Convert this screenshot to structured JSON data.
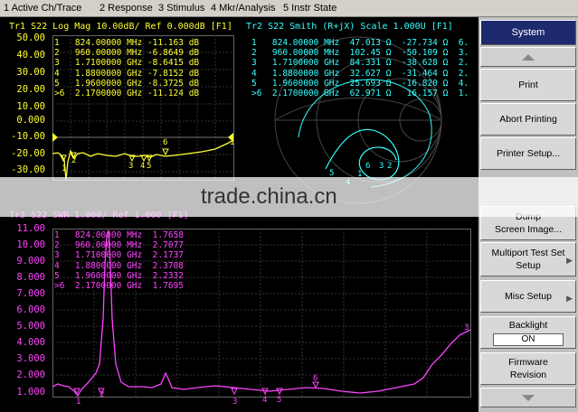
{
  "menu": [
    "1 Active Ch/Trace",
    "2 Response",
    "3 Stimulus",
    "4 Mkr/Analysis",
    "5 Instr State"
  ],
  "trace1": {
    "header": "Tr1 S22 Log Mag 10.00dB/ Ref 0.000dB [F1]",
    "yticks": [
      "50.00",
      "40.00",
      "30.00",
      "20.00",
      "10.00",
      "0.000",
      "-10.00",
      "-20.00",
      "-30.00"
    ],
    "markers": [
      "1   824.00000 MHz -11.163 dB",
      "2   960.00000 MHz -6.8649 dB",
      "3   1.7100000 GHz -8.6415 dB",
      "4   1.8800000 GHz -7.8152 dB",
      "5   1.9600000 GHz -8.3725 dB",
      ">6  2.1700000 GHz -11.124 dB"
    ],
    "marker_labels": [
      "1",
      "2",
      "3",
      "4",
      "5",
      "6",
      "1"
    ],
    "color": "#ffff33"
  },
  "trace2": {
    "header": "Tr2 S22 Smith (R+jX) Scale 1.000U [F1]",
    "markers": [
      "1   824.00000 MHz  47.013 Ω  -27.734 Ω  6.",
      "2   960.00000 MHz  102.45 Ω  -50.109 Ω  3.",
      "3   1.7100000 GHz  84.331 Ω  -38.628 Ω  2.",
      "4   1.8800000 GHz  32.627 Ω  -31.464 Ω  2.",
      "5   1.9600000 GHz  25.693 Ω  -16.820 Ω  4.",
      ">6  2.1700000 GHz  62.971 Ω   16.157 Ω  1."
    ],
    "marker_labels": [
      "5",
      "4",
      "1",
      "6",
      "3",
      "2"
    ],
    "color": "#33ffff"
  },
  "trace3": {
    "header": "Tr3 S22 SWR 1.000/ Ref 1.000 [F1]",
    "yticks": [
      "11.00",
      "10.00",
      "9.000",
      "8.000",
      "7.000",
      "6.000",
      "5.000",
      "4.000",
      "3.000",
      "2.000",
      "1.000"
    ],
    "markers": [
      "1   824.00000 MHz  1.7658",
      "2   960.00000 MHz  2.7077",
      "3   1.7100000 GHz  2.1737",
      "4   1.8800000 GHz  2.3708",
      "5   1.9600000 GHz  2.2332",
      ">6  2.1700000 GHz  1.7695"
    ],
    "marker_labels": [
      "1",
      "2",
      "3",
      "4",
      "5",
      "6",
      "3"
    ],
    "color": "#ff44ff"
  },
  "softkeys": {
    "title": "System",
    "print": "Print",
    "abort_printing": "Abort Printing",
    "printer_setup": "Printer Setup...",
    "dump_line1": "Dump",
    "dump_line2": "Screen Image...",
    "multiport_line1": "Multiport Test Set",
    "multiport_line2": "Setup",
    "misc_setup": "Misc Setup",
    "backlight": "Backlight",
    "backlight_state": "ON",
    "firmware_line1": "Firmware",
    "firmware_line2": "Revision"
  },
  "watermark": "trade.china.cn"
}
